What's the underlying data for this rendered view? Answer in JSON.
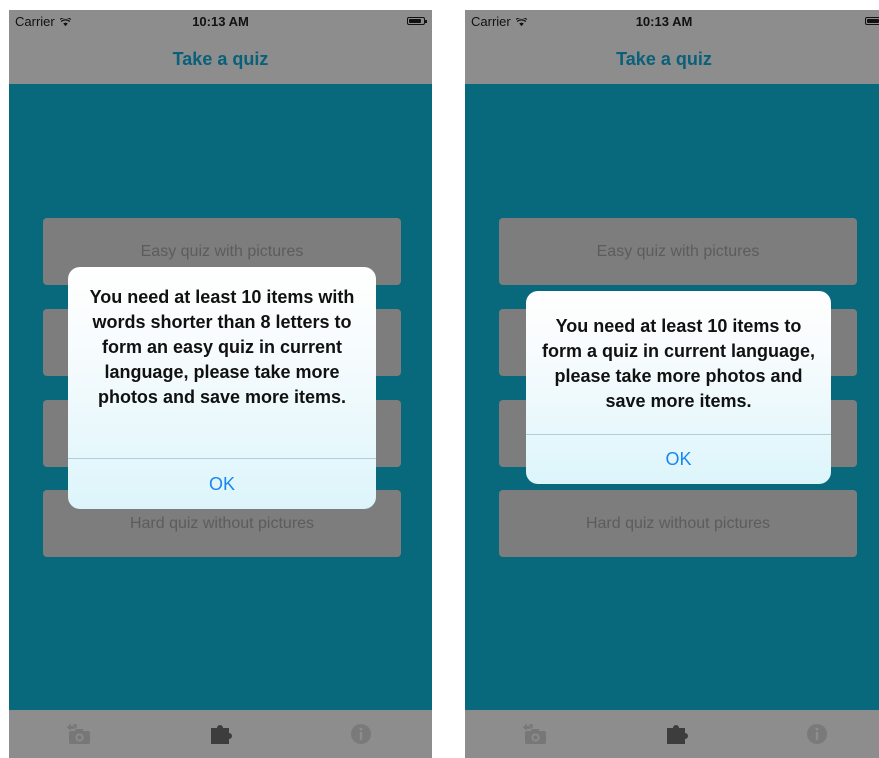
{
  "status": {
    "carrier": "Carrier",
    "time": "10:13 AM",
    "battery_level": 0.75
  },
  "nav": {
    "title": "Take a quiz"
  },
  "quiz_buttons": {
    "easy_with_pictures": "Easy quiz with pictures",
    "hard_without_pictures": "Hard quiz without pictures"
  },
  "tabs": [
    "add-photo-icon",
    "puzzle-piece-icon",
    "info-icon"
  ],
  "alerts": {
    "left": {
      "message": "You need at least 10 items with words shorter than 8 letters to form an easy quiz in current language, please take more photos and save more items.",
      "ok": "OK"
    },
    "right": {
      "message": "You need at least 10 items to form a quiz in current language, please take more photos and save more items.",
      "ok": "OK"
    }
  },
  "colors": {
    "content": "#08697d",
    "title": "#09607a",
    "overlay": "#8d8d8d",
    "ok": "#1a86f0"
  }
}
